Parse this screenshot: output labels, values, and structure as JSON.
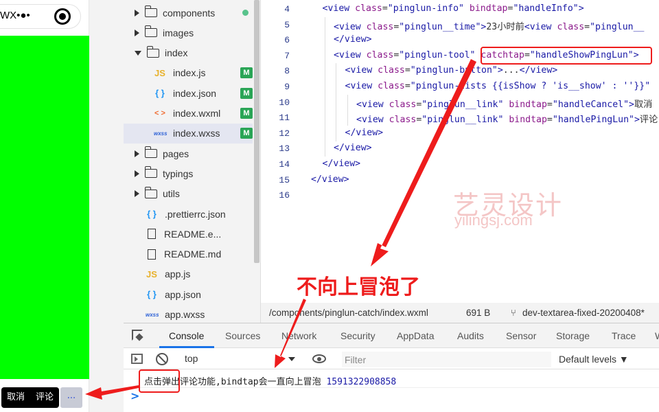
{
  "simulator": {
    "title": "WX•●•",
    "cancel_label": "取消",
    "comment_label": "评论",
    "more_label": "..."
  },
  "explorer": {
    "items": [
      {
        "label": "components",
        "type": "folder",
        "open": false,
        "modified": true
      },
      {
        "label": "images",
        "type": "folder",
        "open": false
      },
      {
        "label": "index",
        "type": "folder",
        "open": true
      },
      {
        "label": "index.js",
        "type": "js",
        "badge": "M"
      },
      {
        "label": "index.json",
        "type": "json",
        "badge": "M"
      },
      {
        "label": "index.wxml",
        "type": "wxml",
        "badge": "M"
      },
      {
        "label": "index.wxss",
        "type": "wxss",
        "badge": "M",
        "selected": true
      },
      {
        "label": "pages",
        "type": "folder",
        "open": false
      },
      {
        "label": "typings",
        "type": "folder",
        "open": false
      },
      {
        "label": "utils",
        "type": "folder",
        "open": false
      },
      {
        "label": ".prettierrc.json",
        "type": "json"
      },
      {
        "label": "README.e...",
        "type": "doc"
      },
      {
        "label": "README.md",
        "type": "doc"
      },
      {
        "label": "app.js",
        "type": "js"
      },
      {
        "label": "app.json",
        "type": "json"
      },
      {
        "label": "app.wxss",
        "type": "wxss"
      }
    ],
    "icons": {
      "js": "JS",
      "json": "{ }",
      "wxml": "< >",
      "wxss": "wxss"
    }
  },
  "editor": {
    "line_numbers": [
      "4",
      "5",
      "6",
      "7",
      "8",
      "9",
      "10",
      "11",
      "12",
      "13",
      "14",
      "15",
      "16"
    ],
    "lines": [
      {
        "indent": 1,
        "parts": [
          [
            "t",
            "<view "
          ],
          [
            "a",
            "class"
          ],
          [
            "p",
            "="
          ],
          [
            "s",
            "\"pinglun-info\""
          ],
          [
            "p",
            " "
          ],
          [
            "a",
            "bindtap"
          ],
          [
            "p",
            "="
          ],
          [
            "s",
            "\"handleInfo\""
          ],
          [
            "t",
            ">"
          ]
        ]
      },
      {
        "indent": 2,
        "parts": [
          [
            "t",
            "<view "
          ],
          [
            "a",
            "class"
          ],
          [
            "p",
            "="
          ],
          [
            "s",
            "\"pinglun__time\""
          ],
          [
            "t",
            ">"
          ],
          [
            "p",
            "23小时前"
          ],
          [
            "t",
            "<view "
          ],
          [
            "a",
            "class"
          ],
          [
            "p",
            "="
          ],
          [
            "s",
            "\"pinglun__"
          ]
        ]
      },
      {
        "indent": 2,
        "parts": [
          [
            "t",
            "</view>"
          ]
        ]
      },
      {
        "indent": 2,
        "parts": [
          [
            "t",
            "<view "
          ],
          [
            "a",
            "class"
          ],
          [
            "p",
            "="
          ],
          [
            "s",
            "\"pinglun-tool\""
          ],
          [
            "p",
            " "
          ],
          [
            "a",
            "catchtap"
          ],
          [
            "p",
            "="
          ],
          [
            "s",
            "\"handleShowPingLun\""
          ],
          [
            "t",
            ">"
          ]
        ]
      },
      {
        "indent": 3,
        "parts": [
          [
            "t",
            "<view "
          ],
          [
            "a",
            "class"
          ],
          [
            "p",
            "="
          ],
          [
            "s",
            "\"pinglun-button\""
          ],
          [
            "t",
            ">"
          ],
          [
            "p",
            "..."
          ],
          [
            "t",
            "</view>"
          ]
        ]
      },
      {
        "indent": 3,
        "parts": [
          [
            "t",
            "<view "
          ],
          [
            "a",
            "class"
          ],
          [
            "p",
            "="
          ],
          [
            "s",
            "\"pinglun-lists {{isShow ? 'is__show' : ''}}\""
          ]
        ]
      },
      {
        "indent": 4,
        "parts": [
          [
            "t",
            "<view "
          ],
          [
            "a",
            "class"
          ],
          [
            "p",
            "="
          ],
          [
            "s",
            "\"pinglun__link\""
          ],
          [
            "p",
            " "
          ],
          [
            "a",
            "bindtap"
          ],
          [
            "p",
            "="
          ],
          [
            "s",
            "\"handleCancel\""
          ],
          [
            "t",
            ">"
          ],
          [
            "p",
            "取消"
          ]
        ]
      },
      {
        "indent": 4,
        "parts": [
          [
            "t",
            "<view "
          ],
          [
            "a",
            "class"
          ],
          [
            "p",
            "="
          ],
          [
            "s",
            "\"pinglun__link\""
          ],
          [
            "p",
            " "
          ],
          [
            "a",
            "bindtap"
          ],
          [
            "p",
            "="
          ],
          [
            "s",
            "\"handlePingLun\""
          ],
          [
            "t",
            ">"
          ],
          [
            "p",
            "评论"
          ]
        ]
      },
      {
        "indent": 3,
        "parts": [
          [
            "t",
            "</view>"
          ]
        ]
      },
      {
        "indent": 2,
        "parts": [
          [
            "t",
            "</view>"
          ]
        ]
      },
      {
        "indent": 1,
        "parts": [
          [
            "t",
            "</view>"
          ]
        ]
      },
      {
        "indent": 0,
        "parts": [
          [
            "t",
            "</view>"
          ]
        ]
      },
      {
        "indent": 0,
        "parts": []
      }
    ],
    "watermark_cn": "艺灵设计",
    "watermark_en": "yilingsj.com"
  },
  "statusbar": {
    "path": "/components/pinglun-catch/index.wxml",
    "size": "691 B",
    "branch": "dev-textarea-fixed-20200408*"
  },
  "devtools": {
    "tabs": [
      "Console",
      "Sources",
      "Network",
      "Security",
      "AppData",
      "Audits",
      "Sensor",
      "Storage",
      "Trace",
      "W"
    ],
    "active_tab": "Console",
    "context": "top",
    "filter_placeholder": "Filter",
    "levels": "Default levels ▼",
    "log_message": "点击弹出评论功能,bindtap会一直向上冒泡",
    "log_timestamp": "1591322908858",
    "prompt": ">"
  },
  "annotation": {
    "callout": "不向上冒泡了",
    "color": "#ee1c1c"
  }
}
